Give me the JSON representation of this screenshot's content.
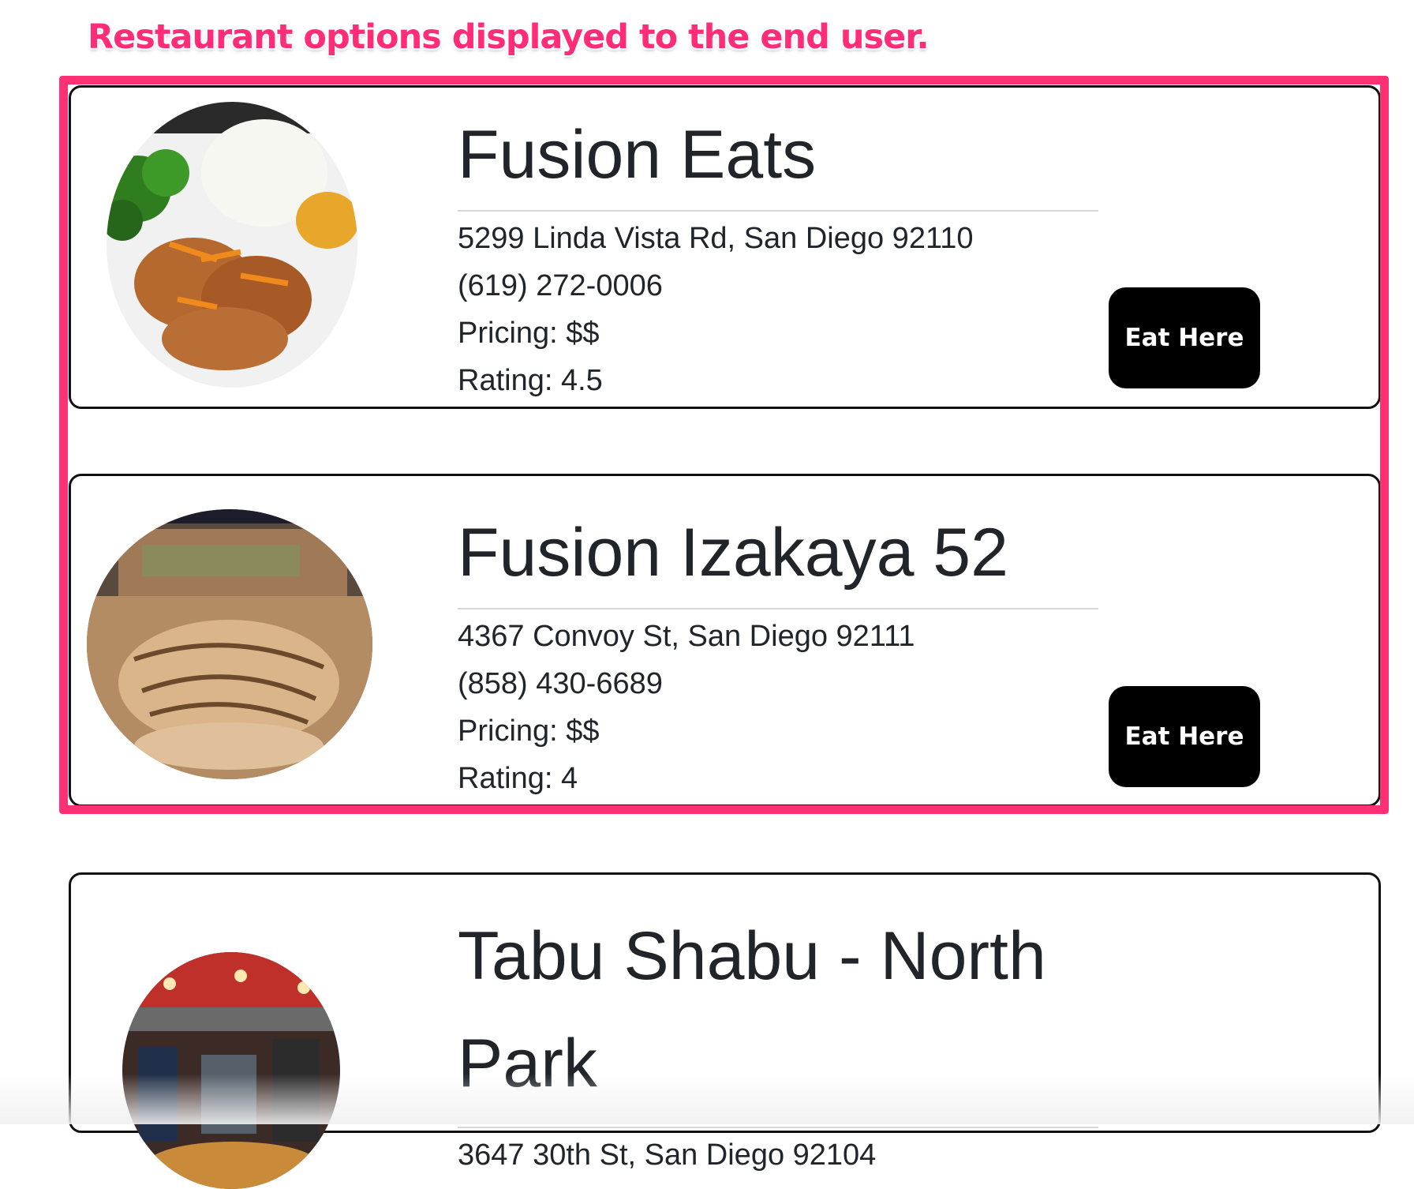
{
  "annotation": {
    "text": "Restaurant options displayed to the end user.",
    "color": "#ff2d78"
  },
  "restaurants": [
    {
      "name": "Fusion Eats",
      "address": "5299 Linda Vista Rd, San Diego 92110",
      "phone": "(619) 272-0006",
      "pricing": "Pricing: $$",
      "rating": "Rating: 4.5",
      "button_label": "Eat Here",
      "photo_icon": "orange-chicken-plate-photo"
    },
    {
      "name": "Fusion Izakaya 52",
      "address": "4367 Convoy St, San Diego 92111",
      "phone": "(858) 430-6689",
      "pricing": "Pricing: $$",
      "rating": "Rating: 4",
      "button_label": "Eat Here",
      "photo_icon": "sushi-roll-photo"
    },
    {
      "name": "Tabu Shabu - North Park",
      "address": "3647 30th St, San Diego 92104",
      "photo_icon": "restaurant-interior-photo"
    }
  ],
  "colors": {
    "highlight": "#ff3174",
    "button_bg": "#000000",
    "text": "#212529"
  }
}
